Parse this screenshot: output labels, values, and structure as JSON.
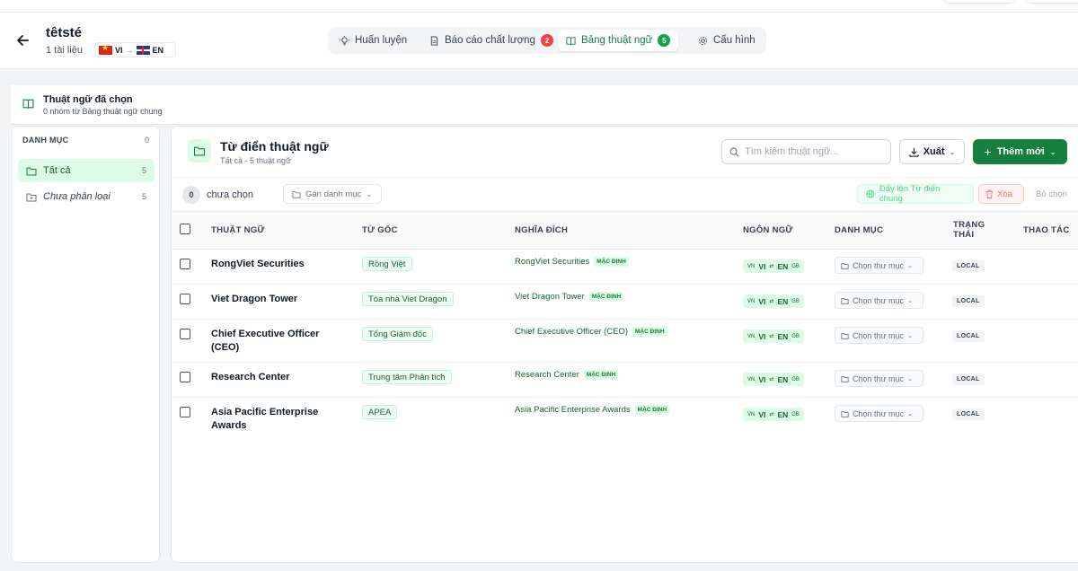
{
  "header": {
    "title": "têtsté",
    "doc_count": "1 tài liệu",
    "source_lang": "VI",
    "target_lang": "EN"
  },
  "tabs": [
    {
      "label": "Huấn luyện",
      "icon": "bulb-icon"
    },
    {
      "label": "Báo cáo chất lượng",
      "icon": "file-icon",
      "badge": "2"
    },
    {
      "label": "Bảng thuật ngữ",
      "icon": "book-icon",
      "badge": "5",
      "active": true
    },
    {
      "label": "Cấu hình",
      "icon": "gear-icon"
    }
  ],
  "selected_glossary": {
    "title": "Thuật ngữ đã chọn",
    "subtitle": "0 nhóm từ Bảng thuật ngữ chung"
  },
  "sidebar": {
    "heading": "DANH MỤC",
    "heading_count": "0",
    "items": [
      {
        "label": "Tất cả",
        "count": "5",
        "active": true
      },
      {
        "label": "Chưa phân loại",
        "count": "5"
      }
    ]
  },
  "main": {
    "title": "Từ điển thuật ngữ",
    "subtitle": "Tất cả - 5 thuật ngữ",
    "search_placeholder": "Tìm kiếm thuật ngữ...",
    "export_label": "Xuất",
    "add_label": "Thêm mới"
  },
  "selection_bar": {
    "count": "0",
    "label": "chưa chọn",
    "assign_label": "Gán danh mục",
    "push_label": "Đẩy lên Từ điển chung",
    "delete_label": "Xóa",
    "deselect_label": "Bỏ chọn"
  },
  "table": {
    "columns": {
      "term": "THUẬT NGỮ",
      "source": "TỪ GỐC",
      "target": "NGHĨA ĐÍCH",
      "language": "NGÔN NGỮ",
      "category": "DANH MỤC",
      "status": "TRẠNG THÁI",
      "actions": "THAO TÁC"
    },
    "rows": [
      {
        "term": "RongViet Securities",
        "source": "Rồng Việt",
        "target": "RongViet Securities",
        "default_badge": "MẶC ĐỊNH",
        "src_code": "VN",
        "src": "VI",
        "tgt": "EN",
        "tgt_code": "GB",
        "category": "Chọn thư mục",
        "status": "LOCAL"
      },
      {
        "term": "Viet Dragon Tower",
        "source": "Tòa nhà Viet Dragon",
        "target": "Viet Dragon Tower",
        "default_badge": "MẶC ĐỊNH",
        "src_code": "VN",
        "src": "VI",
        "tgt": "EN",
        "tgt_code": "GB",
        "category": "Chọn thư mục",
        "status": "LOCAL"
      },
      {
        "term": "Chief Executive Officer (CEO)",
        "source": "Tổng Giám đốc",
        "target": "Chief Executive Officer (CEO)",
        "default_badge": "MẶC ĐỊNH",
        "src_code": "VN",
        "src": "VI",
        "tgt": "EN",
        "tgt_code": "GB",
        "category": "Chọn thư mục",
        "status": "LOCAL"
      },
      {
        "term": "Research Center",
        "source": "Trung tâm Phân tích",
        "target": "Research Center",
        "default_badge": "MẶC ĐỊNH",
        "src_code": "VN",
        "src": "VI",
        "tgt": "EN",
        "tgt_code": "GB",
        "category": "Chọn thư mục",
        "status": "LOCAL"
      },
      {
        "term": "Asia Pacific Enterprise Awards",
        "source": "APEA",
        "target": "Asia Pacific Enterprise Awards",
        "default_badge": "MẶC ĐỊNH",
        "src_code": "VN",
        "src": "VI",
        "tgt": "EN",
        "tgt_code": "GB",
        "category": "Chọn thư mục",
        "status": "LOCAL"
      }
    ]
  },
  "colors": {
    "accent": "#15803d",
    "accent_light": "#dcfce7",
    "badge_red": "#ef4444"
  }
}
